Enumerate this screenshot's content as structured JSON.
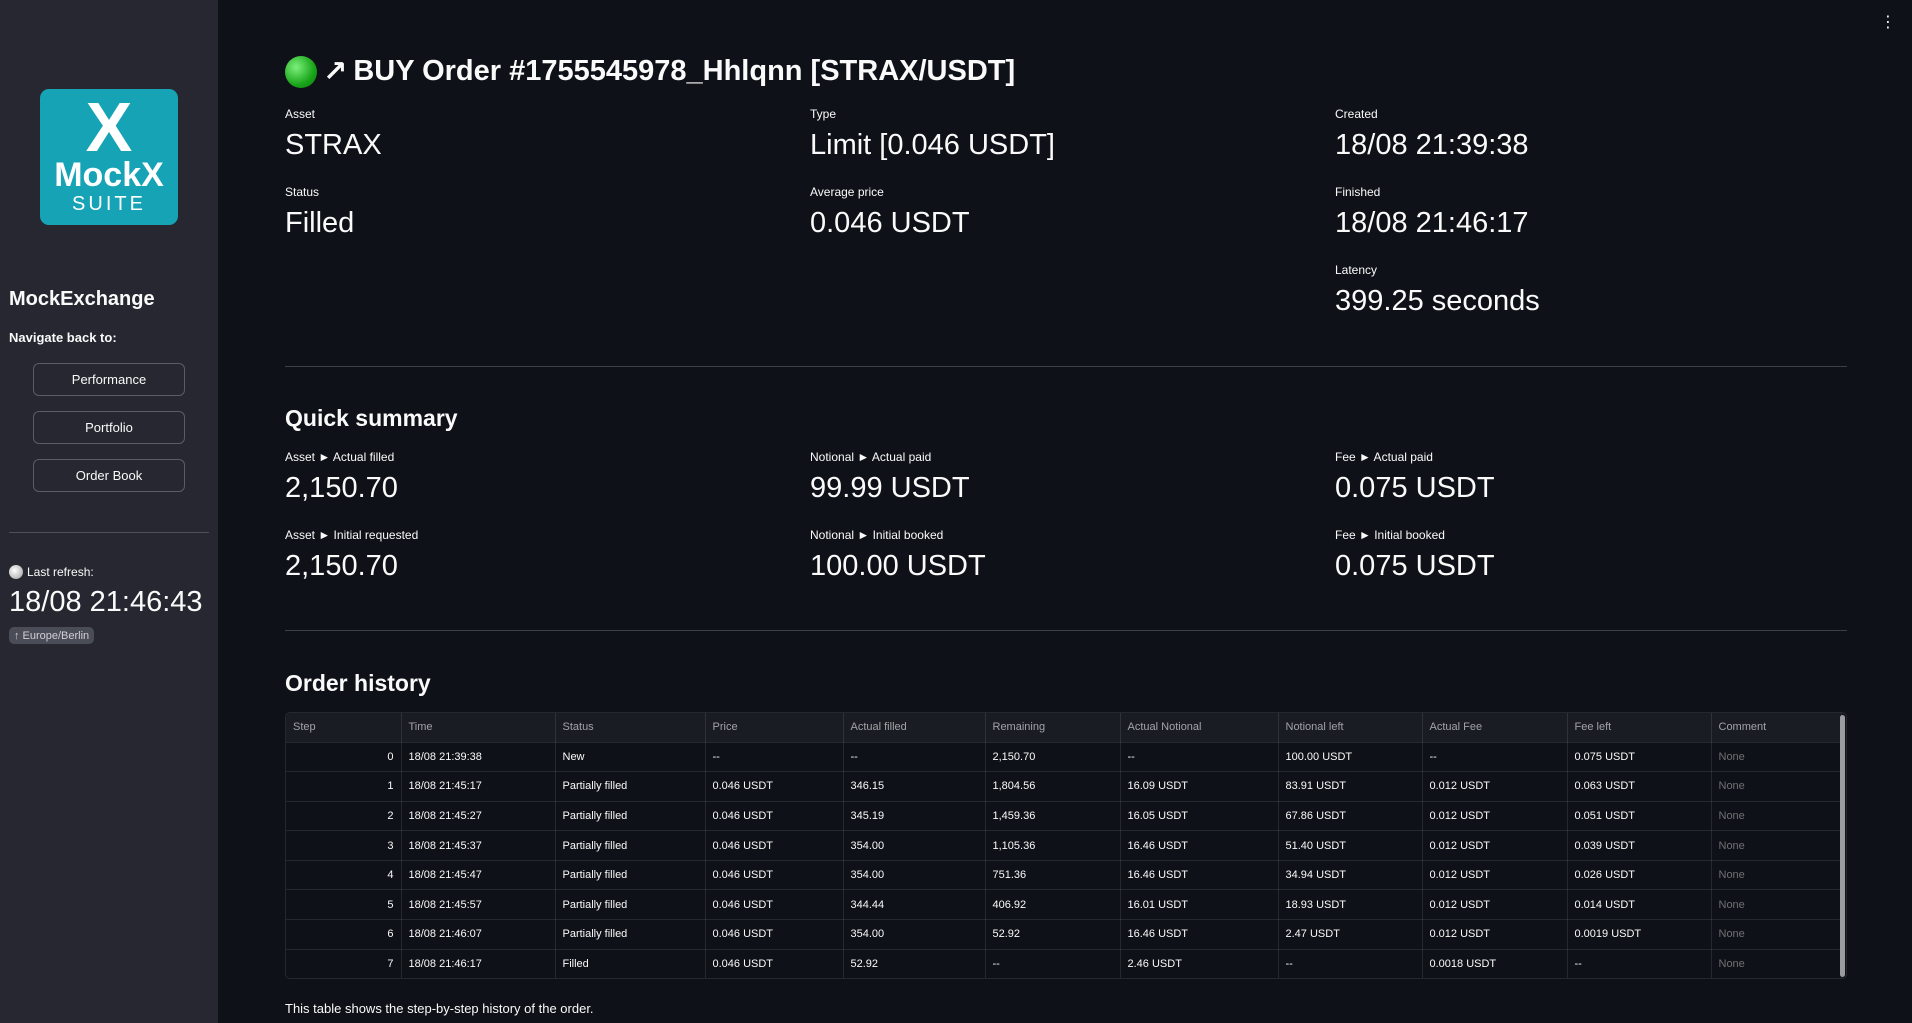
{
  "sidebar": {
    "logo": {
      "mark": "X",
      "brand": "MockX",
      "suite": "SUITE"
    },
    "app_name": "MockExchange",
    "nav_label": "Navigate back to:",
    "nav_buttons": [
      "Performance",
      "Portfolio",
      "Order Book"
    ],
    "refresh_label": "Last refresh:",
    "refresh_time": "18/08 21:46:43",
    "timezone": "Europe/Berlin"
  },
  "header": {
    "title": "BUY Order #1755545978_Hhlqnn [STRAX/USDT]",
    "status_color": "#22b822",
    "arrow": "↗"
  },
  "details": {
    "asset": {
      "label": "Asset",
      "value": "STRAX"
    },
    "type": {
      "label": "Type",
      "value": "Limit [0.046 USDT]"
    },
    "created": {
      "label": "Created",
      "value": "18/08 21:39:38"
    },
    "status": {
      "label": "Status",
      "value": "Filled"
    },
    "avg_price": {
      "label": "Average price",
      "value": "0.046 USDT"
    },
    "finished": {
      "label": "Finished",
      "value": "18/08 21:46:17"
    },
    "latency": {
      "label": "Latency",
      "value": "399.25 seconds"
    }
  },
  "summary": {
    "title": "Quick summary",
    "asset_filled": {
      "label": "Asset ► Actual filled",
      "value": "2,150.70"
    },
    "notional_paid": {
      "label": "Notional ► Actual paid",
      "value": "99.99 USDT"
    },
    "fee_paid": {
      "label": "Fee ► Actual paid",
      "value": "0.075 USDT"
    },
    "asset_requested": {
      "label": "Asset ► Initial requested",
      "value": "2,150.70"
    },
    "notional_booked": {
      "label": "Notional ► Initial booked",
      "value": "100.00 USDT"
    },
    "fee_booked": {
      "label": "Fee ► Initial booked",
      "value": "0.075 USDT"
    }
  },
  "history": {
    "title": "Order history",
    "columns": [
      "Step",
      "Time",
      "Status",
      "Price",
      "Actual filled",
      "Remaining",
      "Actual Notional",
      "Notional left",
      "Actual Fee",
      "Fee left",
      "Comment"
    ],
    "rows": [
      [
        "0",
        "18/08 21:39:38",
        "New",
        "--",
        "--",
        "2,150.70",
        "--",
        "100.00 USDT",
        "--",
        "0.075 USDT",
        "None"
      ],
      [
        "1",
        "18/08 21:45:17",
        "Partially filled",
        "0.046 USDT",
        "346.15",
        "1,804.56",
        "16.09 USDT",
        "83.91 USDT",
        "0.012 USDT",
        "0.063 USDT",
        "None"
      ],
      [
        "2",
        "18/08 21:45:27",
        "Partially filled",
        "0.046 USDT",
        "345.19",
        "1,459.36",
        "16.05 USDT",
        "67.86 USDT",
        "0.012 USDT",
        "0.051 USDT",
        "None"
      ],
      [
        "3",
        "18/08 21:45:37",
        "Partially filled",
        "0.046 USDT",
        "354.00",
        "1,105.36",
        "16.46 USDT",
        "51.40 USDT",
        "0.012 USDT",
        "0.039 USDT",
        "None"
      ],
      [
        "4",
        "18/08 21:45:47",
        "Partially filled",
        "0.046 USDT",
        "354.00",
        "751.36",
        "16.46 USDT",
        "34.94 USDT",
        "0.012 USDT",
        "0.026 USDT",
        "None"
      ],
      [
        "5",
        "18/08 21:45:57",
        "Partially filled",
        "0.046 USDT",
        "344.44",
        "406.92",
        "16.01 USDT",
        "18.93 USDT",
        "0.012 USDT",
        "0.014 USDT",
        "None"
      ],
      [
        "6",
        "18/08 21:46:07",
        "Partially filled",
        "0.046 USDT",
        "354.00",
        "52.92",
        "16.46 USDT",
        "2.47 USDT",
        "0.012 USDT",
        "0.0019 USDT",
        "None"
      ],
      [
        "7",
        "18/08 21:46:17",
        "Filled",
        "0.046 USDT",
        "52.92",
        "--",
        "2.46 USDT",
        "--",
        "0.0018 USDT",
        "--",
        "None"
      ]
    ],
    "caption": "This table shows the step-by-step history of the order."
  }
}
